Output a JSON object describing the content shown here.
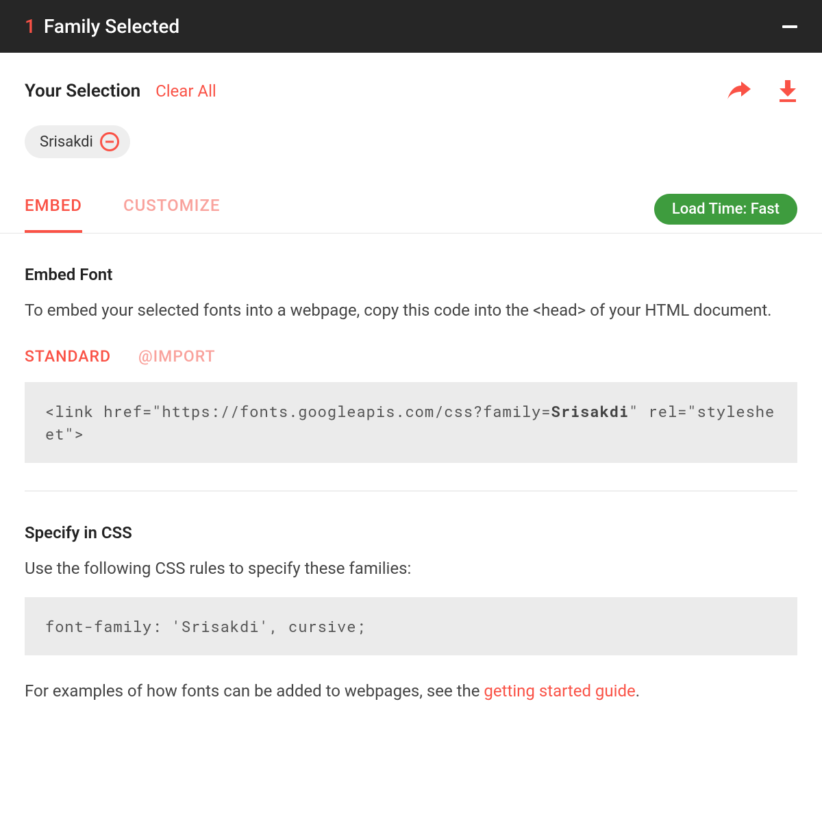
{
  "header": {
    "count": "1",
    "title": "Family Selected"
  },
  "selection": {
    "label": "Your Selection",
    "clear_all": "Clear All",
    "chip_name": "Srisakdi"
  },
  "tabs": {
    "embed": "EMBED",
    "customize": "CUSTOMIZE",
    "load_time": "Load Time: Fast"
  },
  "embed_section": {
    "title": "Embed Font",
    "desc": "To embed your selected fonts into a webpage, copy this code into the <head> of your HTML document.",
    "standard": "STANDARD",
    "import": "@IMPORT",
    "code_prefix": "<link href=\"https://fonts.googleapis.com/css?family=",
    "code_family": "Srisakdi",
    "code_suffix": "\" rel=\"stylesheet\">"
  },
  "css_section": {
    "title": "Specify in CSS",
    "desc": "Use the following CSS rules to specify these families:",
    "code": "font-family: 'Srisakdi', cursive;",
    "footer_prefix": "For examples of how fonts can be added to webpages, see the ",
    "footer_link": "getting started guide",
    "footer_suffix": "."
  }
}
